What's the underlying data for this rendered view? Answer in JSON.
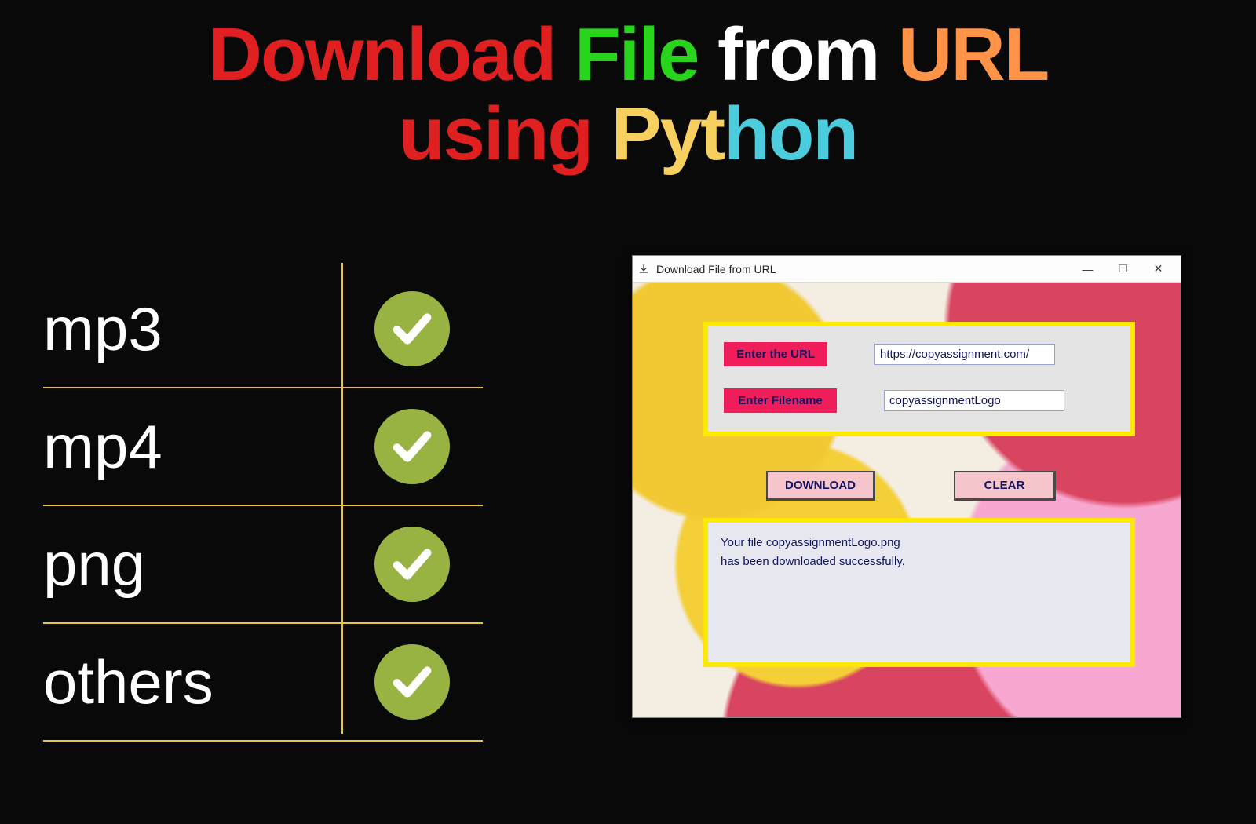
{
  "title": {
    "w1": "Download",
    "w2": "File",
    "w3": "from",
    "w4": "URL",
    "w5": "using",
    "w6a": "Pyt",
    "w6b": "hon"
  },
  "formats": [
    {
      "label": "mp3"
    },
    {
      "label": "mp4"
    },
    {
      "label": "png"
    },
    {
      "label": "others"
    }
  ],
  "window": {
    "title": "Download File from URL",
    "minimize": "—",
    "maximize": "☐",
    "close": "✕",
    "fields": {
      "url_label": "Enter the URL",
      "url_value": "https://copyassignment.com/",
      "filename_label": "Enter Filename",
      "filename_value": "copyassignmentLogo"
    },
    "buttons": {
      "download": "DOWNLOAD",
      "clear": "CLEAR"
    },
    "status_line1": "Your file copyassignmentLogo.png",
    "status_line2": " has been downloaded successfully."
  }
}
